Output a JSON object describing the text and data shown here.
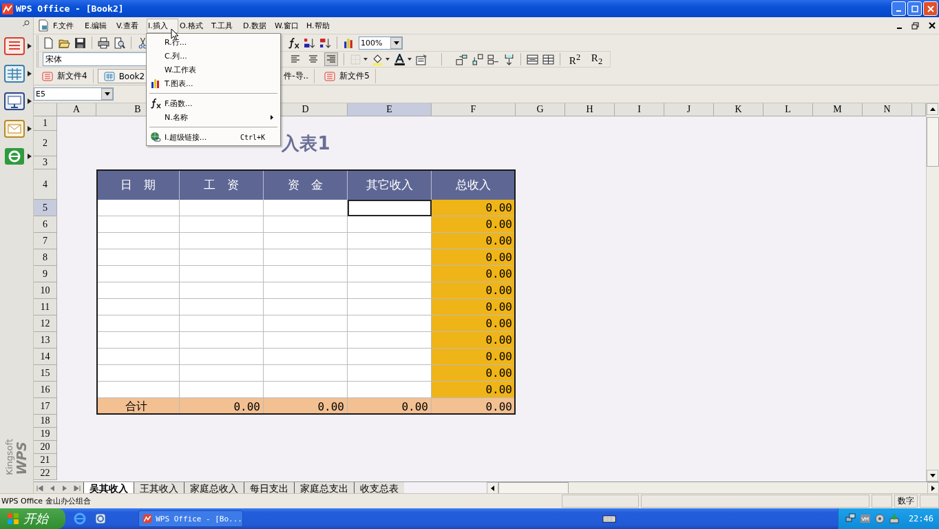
{
  "window": {
    "title": "WPS Office - [Book2]"
  },
  "dock": {
    "items": [
      {
        "kind": "writer"
      },
      {
        "kind": "spreadsheet"
      },
      {
        "kind": "presentation"
      },
      {
        "kind": "mail"
      },
      {
        "kind": "browser"
      }
    ],
    "logo": [
      "Kingsoft",
      "WPS"
    ]
  },
  "menu_bar": [
    {
      "label": "F.文件",
      "selected": false
    },
    {
      "label": "E.编辑",
      "selected": false
    },
    {
      "label": "V.查看",
      "selected": false
    },
    {
      "label": "I.插入",
      "selected": true
    },
    {
      "label": "O.格式",
      "selected": false
    },
    {
      "label": "T.工具",
      "selected": false
    },
    {
      "label": "D.数据",
      "selected": false
    },
    {
      "label": "W.窗口",
      "selected": false
    },
    {
      "label": "H.帮助",
      "selected": false
    }
  ],
  "insert_menu": [
    {
      "kind": "plain",
      "label": "R.行..."
    },
    {
      "kind": "plain",
      "label": "C.列..."
    },
    {
      "kind": "plain",
      "label": "W.工作表"
    },
    {
      "kind": "chart",
      "label": "T.图表..."
    },
    {
      "kind": "separator"
    },
    {
      "kind": "function",
      "label": "F.函数..."
    },
    {
      "kind": "submenu",
      "label": "N.名称"
    },
    {
      "kind": "separator"
    },
    {
      "kind": "link",
      "label": "I.超级链接...",
      "shortcut": "Ctrl+K"
    }
  ],
  "toolbar": {
    "zoom": "100%"
  },
  "format_toolbar": {
    "font_name": "宋体",
    "align_buttons": [
      {
        "kind": "left",
        "selected": false
      },
      {
        "kind": "center",
        "selected": false
      },
      {
        "kind": "right",
        "selected": true
      }
    ],
    "script_buttons": [
      "R$^{2}$",
      "R$_{2}$"
    ]
  },
  "doc_tabs": [
    {
      "label": "新文件4",
      "kind": "writer",
      "selected": false
    },
    {
      "label": "Book2",
      "kind": "spreadsheet",
      "selected": true
    },
    {
      "label": "件-导..",
      "kind": "partial",
      "selected": false
    },
    {
      "label": "新文件5",
      "kind": "writer",
      "selected": false
    }
  ],
  "name_box": "E5",
  "sheet": {
    "columns": [
      {
        "label": "A",
        "selected": false
      },
      {
        "label": "B",
        "selected": false
      },
      null,
      {
        "label": "D",
        "selected": false
      },
      {
        "label": "E",
        "selected": true
      },
      {
        "label": "F",
        "selected": false
      },
      {
        "label": "G",
        "selected": false
      },
      {
        "label": "H",
        "selected": false
      },
      {
        "label": "I",
        "selected": false
      },
      {
        "label": "J",
        "selected": false
      },
      {
        "label": "K",
        "selected": false
      },
      {
        "label": "L",
        "selected": false
      },
      {
        "label": "M",
        "selected": false
      },
      {
        "label": "N",
        "selected": false
      }
    ],
    "rows": [
      {
        "label": "1",
        "selected": false
      },
      {
        "label": "2",
        "selected": false
      },
      {
        "label": "3",
        "selected": false
      },
      {
        "label": "4",
        "selected": false
      },
      {
        "label": "5",
        "selected": true
      },
      {
        "label": "6",
        "selected": false
      },
      {
        "label": "7",
        "selected": false
      },
      {
        "label": "8",
        "selected": false
      },
      {
        "label": "9",
        "selected": false
      },
      {
        "label": "10",
        "selected": false
      },
      {
        "label": "11",
        "selected": false
      },
      {
        "label": "12",
        "selected": false
      },
      {
        "label": "13",
        "selected": false
      },
      {
        "label": "14",
        "selected": false
      },
      {
        "label": "15",
        "selected": false
      },
      {
        "label": "16",
        "selected": false
      },
      {
        "label": "17",
        "selected": false
      },
      {
        "label": "18",
        "selected": false
      },
      {
        "label": "19",
        "selected": false
      },
      {
        "label": "20",
        "selected": false
      },
      {
        "label": "21",
        "selected": false
      },
      {
        "label": "22",
        "selected": false
      }
    ],
    "title": "入表1",
    "table_header": [
      "日　期",
      "工　资",
      "资　金",
      "其它收入",
      "总收入"
    ],
    "table_rows": [
      {
        "total": "0.00"
      },
      {
        "total": "0.00"
      },
      {
        "total": "0.00"
      },
      {
        "total": "0.00"
      },
      {
        "total": "0.00"
      },
      {
        "total": "0.00"
      },
      {
        "total": "0.00"
      },
      {
        "total": "0.00"
      },
      {
        "total": "0.00"
      },
      {
        "total": "0.00"
      },
      {
        "total": "0.00"
      },
      {
        "total": "0.00"
      }
    ],
    "summary": {
      "label": "合计",
      "values": [
        "0.00",
        "0.00",
        "0.00",
        "0.00"
      ]
    }
  },
  "sheet_tabs": [
    {
      "label": "吴其收入",
      "selected": true
    },
    {
      "label": "王其收入",
      "selected": false
    },
    {
      "label": "家庭总收入",
      "selected": false
    },
    {
      "label": "每日支出",
      "selected": false
    },
    {
      "label": "家庭总支出",
      "selected": false
    },
    {
      "label": "收支总表",
      "selected": false
    }
  ],
  "status_bar": {
    "text": "WPS Office 金山办公组合",
    "mode": "数字"
  },
  "taskbar": {
    "start": "开始",
    "tasks": [
      {
        "label": "WPS Office - [Bo...",
        "selected": false
      }
    ],
    "clock": "22:46"
  }
}
